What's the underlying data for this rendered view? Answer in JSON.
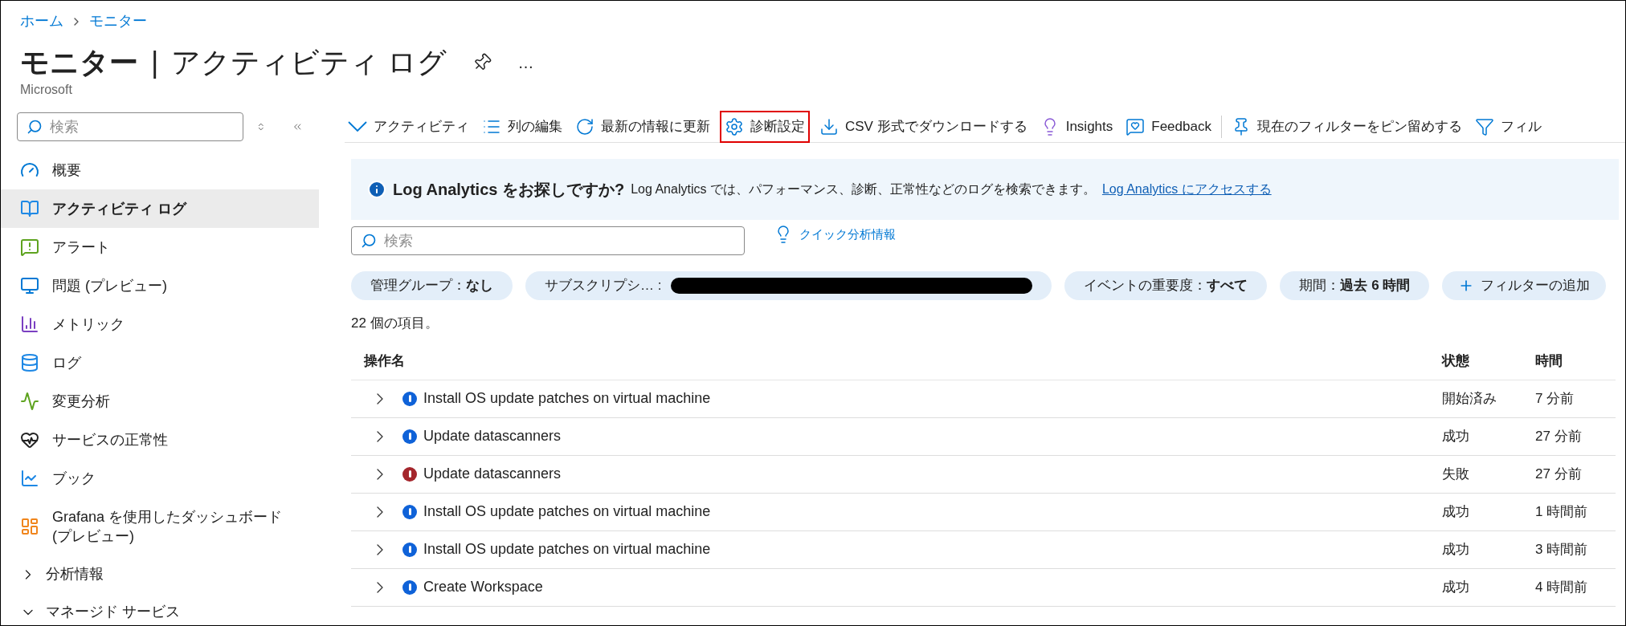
{
  "breadcrumb": [
    "ホーム",
    "モニター"
  ],
  "header": {
    "title": "モニター",
    "separator": "|",
    "subtitle": "アクティビティ ログ",
    "org": "Microsoft",
    "more": "…"
  },
  "sidebar": {
    "search": {
      "placeholder": "検索"
    },
    "items": [
      {
        "kind": "page",
        "label": "概要",
        "selected": false
      },
      {
        "kind": "page",
        "label": "アクティビティ ログ",
        "selected": true
      },
      {
        "kind": "page",
        "label": "アラート",
        "selected": false
      },
      {
        "kind": "page",
        "label": "問題 (プレビュー)",
        "selected": false
      },
      {
        "kind": "page",
        "label": "メトリック",
        "selected": false
      },
      {
        "kind": "page",
        "label": "ログ",
        "selected": false
      },
      {
        "kind": "page",
        "label": "変更分析",
        "selected": false
      },
      {
        "kind": "page",
        "label": "サービスの正常性",
        "selected": false
      },
      {
        "kind": "page",
        "label": "ブック",
        "selected": false
      },
      {
        "kind": "page",
        "label": "Grafana を使用したダッシュボード (プレビュー)",
        "selected": false
      },
      {
        "kind": "group",
        "label": "分析情報",
        "expanded": false
      },
      {
        "kind": "group",
        "label": "マネージド サービス",
        "expanded": true
      }
    ]
  },
  "toolbar": {
    "items": [
      {
        "label": "アクティビティ",
        "highlighted": false
      },
      {
        "label": "列の編集",
        "highlighted": false
      },
      {
        "label": "最新の情報に更新",
        "highlighted": false
      },
      {
        "label": "診断設定",
        "highlighted": true
      },
      {
        "label": "CSV 形式でダウンロードする",
        "highlighted": false
      },
      {
        "label": "Insights",
        "highlighted": false
      },
      {
        "label": "Feedback",
        "highlighted": false
      }
    ],
    "pinned_items": [
      {
        "label": "現在のフィルターをピン留めする"
      },
      {
        "label": "フィル"
      }
    ]
  },
  "banner": {
    "title": "Log Analytics をお探しですか?",
    "text": "Log Analytics では、パフォーマンス、診断、正常性などのログを検索できます。",
    "link": "Log Analytics にアクセスする"
  },
  "search": {
    "placeholder": "検索"
  },
  "quick_insights": "クイック分析情報",
  "filters": [
    {
      "label": "管理グループ：",
      "value": "なし",
      "redacted": false
    },
    {
      "label": "サブスクリプシ… :",
      "redacted": true
    },
    {
      "label": "イベントの重要度：",
      "value": "すべて",
      "redacted": false
    },
    {
      "label": "期間：",
      "value": "過去 6 時間",
      "redacted": false
    }
  ],
  "add_filter": "フィルターの追加",
  "count": "22 個の項目。",
  "table": {
    "columns": [
      "操作名",
      "状態",
      "時間"
    ],
    "rows": [
      {
        "kind": "info",
        "name": "Install OS update patches on virtual machine",
        "status": "開始済み",
        "time": "7 分前"
      },
      {
        "kind": "info",
        "name": "Update datascanners",
        "status": "成功",
        "time": "27 分前"
      },
      {
        "kind": "error",
        "name": "Update datascanners",
        "status": "失敗",
        "time": "27 分前"
      },
      {
        "kind": "info",
        "name": "Install OS update patches on virtual machine",
        "status": "成功",
        "time": "1 時間前"
      },
      {
        "kind": "info",
        "name": "Install OS update patches on virtual machine",
        "status": "成功",
        "time": "3 時間前"
      },
      {
        "kind": "info",
        "name": "Create Workspace",
        "status": "成功",
        "time": "4 時間前"
      }
    ]
  }
}
